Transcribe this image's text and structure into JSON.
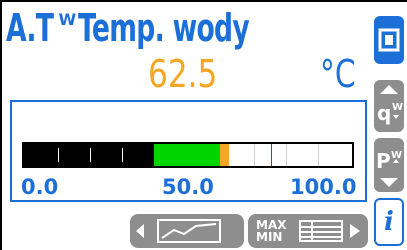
{
  "header": {
    "code": "A.T",
    "code_superscript": "W",
    "title": "Temp. wody"
  },
  "reading": {
    "value": "62.5",
    "unit": "°C"
  },
  "bar": {
    "scale_min": "0.0",
    "scale_mid": "50.0",
    "scale_max": "100.0",
    "level_percent": 62.5
  },
  "side_buttons": {
    "pw_down_sub": "W",
    "pw_up_sub": "W",
    "info_label": "i"
  },
  "bottom_buttons": {
    "minmax_top": "MAX",
    "minmax_bottom": "MIN"
  },
  "colors": {
    "accent": "#1d6fd8",
    "value": "#f5a623",
    "bar_fill": "#00d400",
    "button_grey": "#8e8e8e"
  }
}
